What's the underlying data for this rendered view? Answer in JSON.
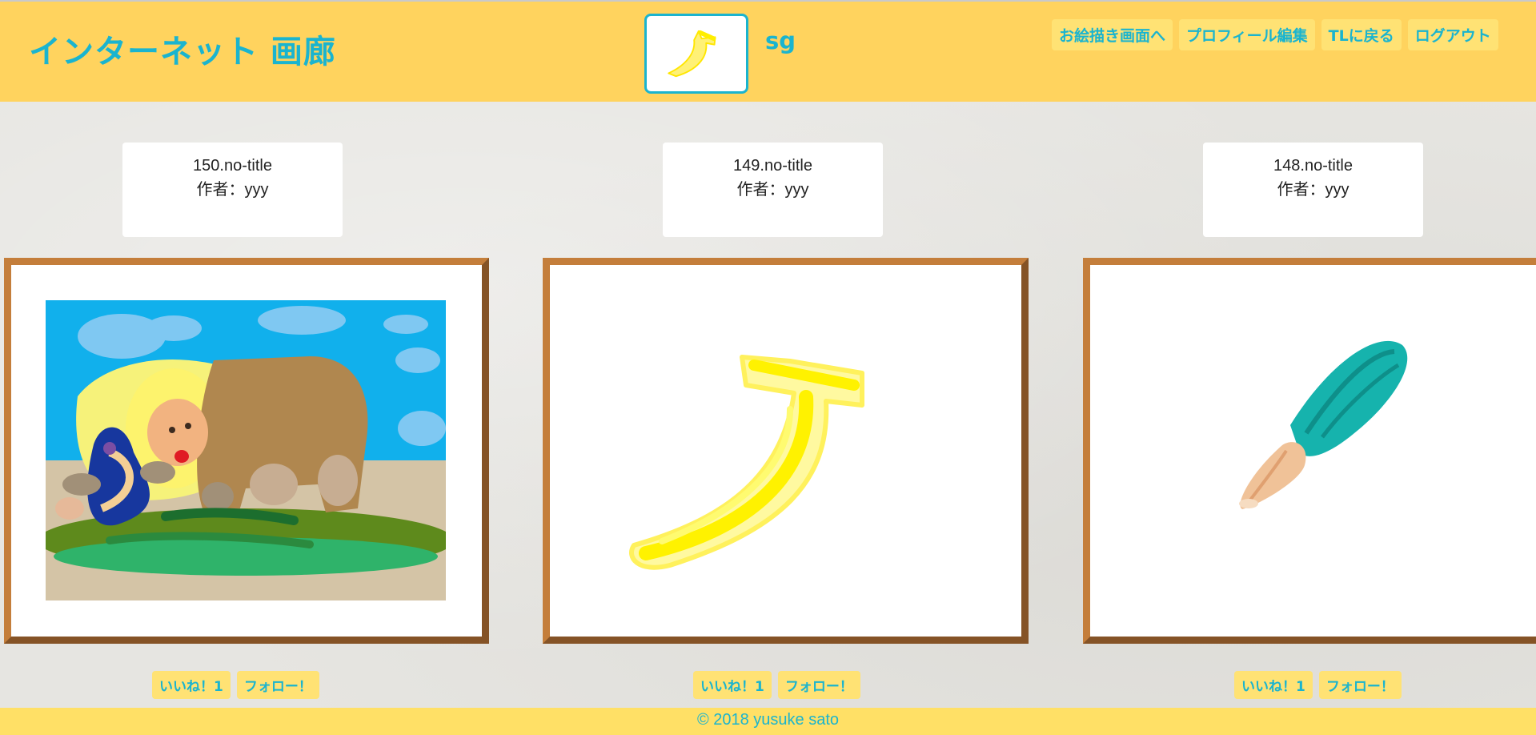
{
  "header": {
    "site_title": "インターネット 画廊",
    "username": "sg",
    "avatar_icon": "banana-drawing-icon",
    "nav": [
      {
        "label": "お絵描き画面へ"
      },
      {
        "label": "プロフィール編集"
      },
      {
        "label": "TLに戻る"
      },
      {
        "label": "ログアウト"
      }
    ]
  },
  "gallery": {
    "items": [
      {
        "title": "150.no-title",
        "author": "作者：yyy",
        "image_icon": "elephant-lion-drawing-icon",
        "like_label": "いいね！1",
        "follow_label": "フォロー！"
      },
      {
        "title": "149.no-title",
        "author": "作者：yyy",
        "image_icon": "banana-drawing-icon",
        "like_label": "いいね！1",
        "follow_label": "フォロー！"
      },
      {
        "title": "148.no-title",
        "author": "作者：yyy",
        "image_icon": "paintbrush-drawing-icon",
        "like_label": "いいね！1",
        "follow_label": "フォロー！"
      }
    ]
  },
  "footer": {
    "copyright": "© 2018 yusuke sato"
  },
  "colors": {
    "header_bg": "#ffd35e",
    "accent": "#1ab4cf",
    "frame_light": "#c47e3b",
    "frame_dark": "#855326"
  }
}
